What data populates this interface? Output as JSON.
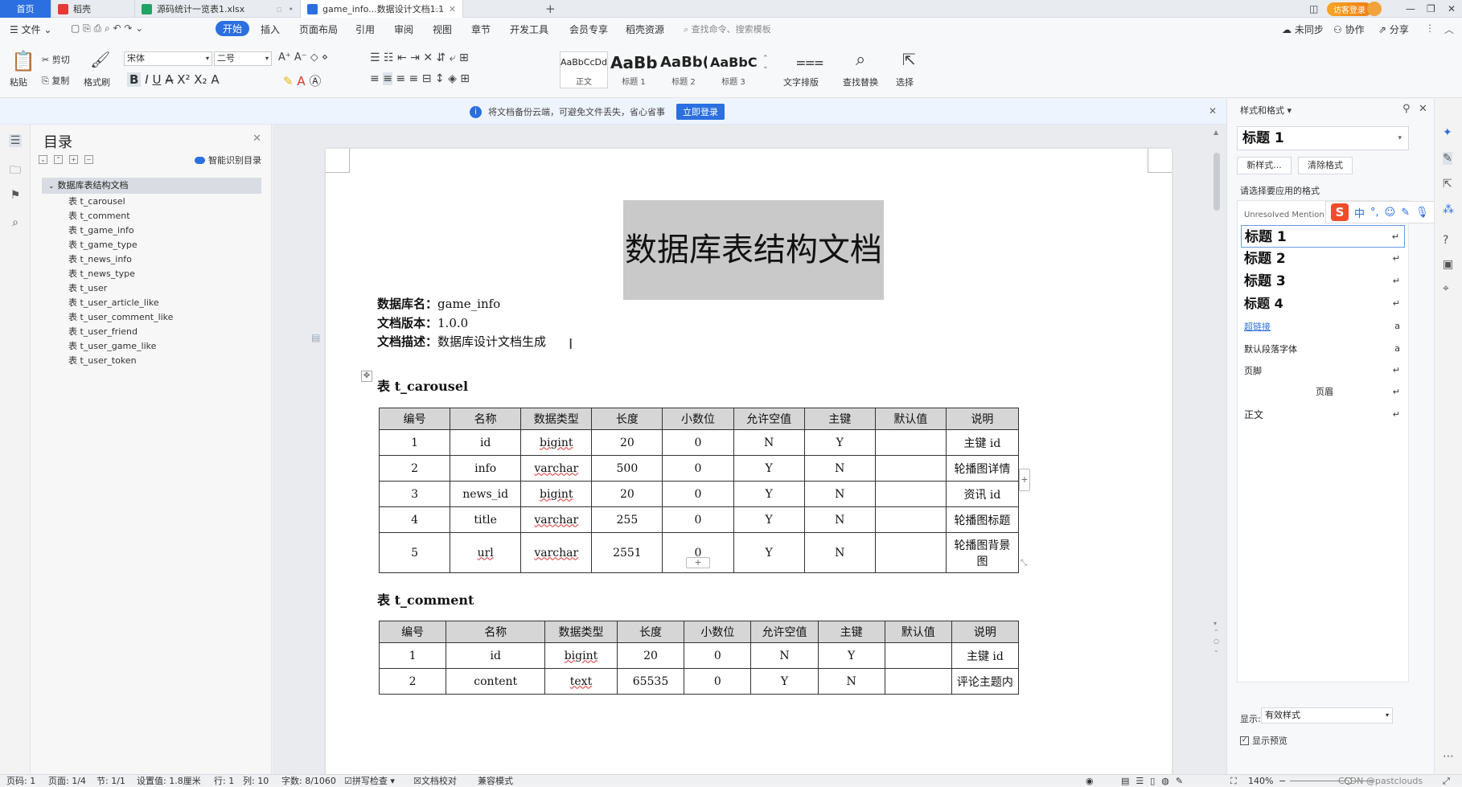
{
  "tabs": {
    "home": "首页",
    "t1": "稻壳",
    "t2": "源码统计一览表1.xlsx",
    "t3": "game_info...数据设计文档1.1",
    "plus": "+"
  },
  "window": {
    "login": "访客登录"
  },
  "menu": {
    "file": "文件",
    "items": [
      "开始",
      "插入",
      "页面布局",
      "引用",
      "审阅",
      "视图",
      "章节",
      "开发工具",
      "会员专享",
      "稻壳资源"
    ],
    "search": "查找命令、搜索模板",
    "sync": "未同步",
    "collab": "协作",
    "share": "分享"
  },
  "ribbon": {
    "paste": "粘贴",
    "cut": "剪切",
    "copy": "复制",
    "format_painter": "格式刷",
    "font": "宋体",
    "size": "二号",
    "styles": [
      {
        "preview": "AaBbCcDd",
        "label": "正文"
      },
      {
        "preview": "AaBb",
        "label": "标题 1"
      },
      {
        "preview": "AaBb(",
        "label": "标题 2"
      },
      {
        "preview": "AaBbC(",
        "label": "标题 3"
      }
    ],
    "text_layout": "文字排版",
    "find_replace": "查找替换",
    "select": "选择"
  },
  "notice": {
    "text": "将文档备份云端，可避免文件丢失，省心省事",
    "button": "立即登录"
  },
  "toc": {
    "title": "目录",
    "smart": "智能识别目录",
    "root": "数据库表结构文档",
    "items": [
      "表 t_carousel",
      "表 t_comment",
      "表 t_game_info",
      "表 t_game_type",
      "表 t_news_info",
      "表 t_news_type",
      "表 t_user",
      "表 t_user_article_like",
      "表 t_user_comment_like",
      "表 t_user_friend",
      "表 t_user_game_like",
      "表 t_user_token"
    ]
  },
  "doc": {
    "title": "数据库表结构文档",
    "db_label": "数据库名：",
    "db_value": "game_info",
    "ver_label": "文档版本：",
    "ver_value": "1.0.0",
    "desc_label": "文档描述：",
    "desc_value": "数据库设计文档生成",
    "sec1": "表 t_carousel",
    "sec2": "表 t_comment",
    "headers": [
      "编号",
      "名称",
      "数据类型",
      "长度",
      "小数位",
      "允许空值",
      "主键",
      "默认值",
      "说明"
    ],
    "table1": [
      [
        "1",
        "id",
        "bigint",
        "20",
        "0",
        "N",
        "Y",
        "",
        "主键 id"
      ],
      [
        "2",
        "info",
        "varchar",
        "500",
        "0",
        "Y",
        "N",
        "",
        "轮播图详情"
      ],
      [
        "3",
        "news_id",
        "bigint",
        "20",
        "0",
        "Y",
        "N",
        "",
        "资讯 id"
      ],
      [
        "4",
        "title",
        "varchar",
        "255",
        "0",
        "Y",
        "N",
        "",
        "轮播图标题"
      ],
      [
        "5",
        "url",
        "varchar",
        "2551",
        "0",
        "Y",
        "N",
        "",
        "轮播图背景图"
      ]
    ],
    "table2": [
      [
        "1",
        "id",
        "bigint",
        "20",
        "0",
        "N",
        "Y",
        "",
        "主键 id"
      ],
      [
        "2",
        "content",
        "text",
        "65535",
        "0",
        "Y",
        "N",
        "",
        "评论主题内"
      ]
    ]
  },
  "panel": {
    "title": "样式和格式",
    "current": "标题 1",
    "new_style": "新样式...",
    "clear": "清除格式",
    "choose": "请选择要应用的格式",
    "items": [
      "Unresolved Mention",
      "标题 1",
      "标题 2",
      "标题 3",
      "标题 4",
      "超链接",
      "默认段落字体",
      "页脚",
      "页眉",
      "正文"
    ],
    "show_label": "显示:",
    "show_value": "有效样式",
    "preview": "显示预览"
  },
  "ime": {
    "lang": "中"
  },
  "status": {
    "page_no": "页码: 1",
    "pages": "页面: 1/4",
    "section": "节: 1/1",
    "setting": "设置值: 1.8厘米",
    "line": "行: 1",
    "col": "列: 10",
    "words": "字数: 8/1060",
    "spell": "拼写检查",
    "proof": "文档校对",
    "compat": "兼容模式",
    "zoom": "140%",
    "watermark": "CSDN @pastclouds"
  }
}
